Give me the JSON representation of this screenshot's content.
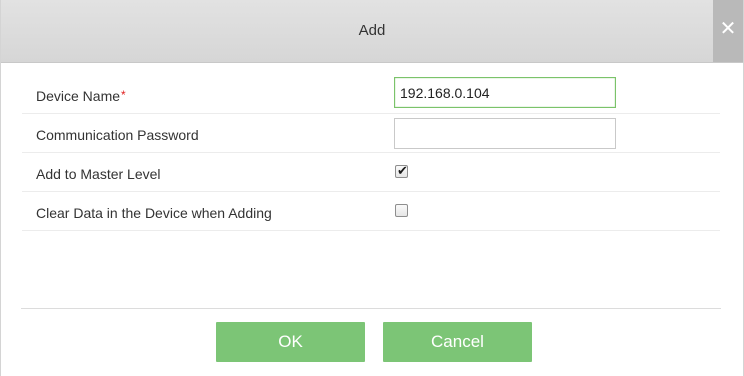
{
  "dialog": {
    "title": "Add",
    "close_symbol": "✕"
  },
  "form": {
    "device_name": {
      "label": "Device Name",
      "required_marker": "*",
      "value": "192.168.0.104"
    },
    "communication_password": {
      "label": "Communication Password",
      "value": ""
    },
    "add_to_master_level": {
      "label": "Add to Master Level",
      "checked": true,
      "check_symbol": "✔"
    },
    "clear_data": {
      "label": "Clear Data in the Device when Adding",
      "checked": false
    }
  },
  "buttons": {
    "ok_label": "OK",
    "cancel_label": "Cancel"
  },
  "colors": {
    "button_green": "#7cc576",
    "focused_border": "#7bc36a",
    "required_red": "#e02020",
    "titlebar_gray": "#dcdcdc"
  },
  "icons": {
    "close": "close-icon",
    "check": "checkmark-icon"
  }
}
